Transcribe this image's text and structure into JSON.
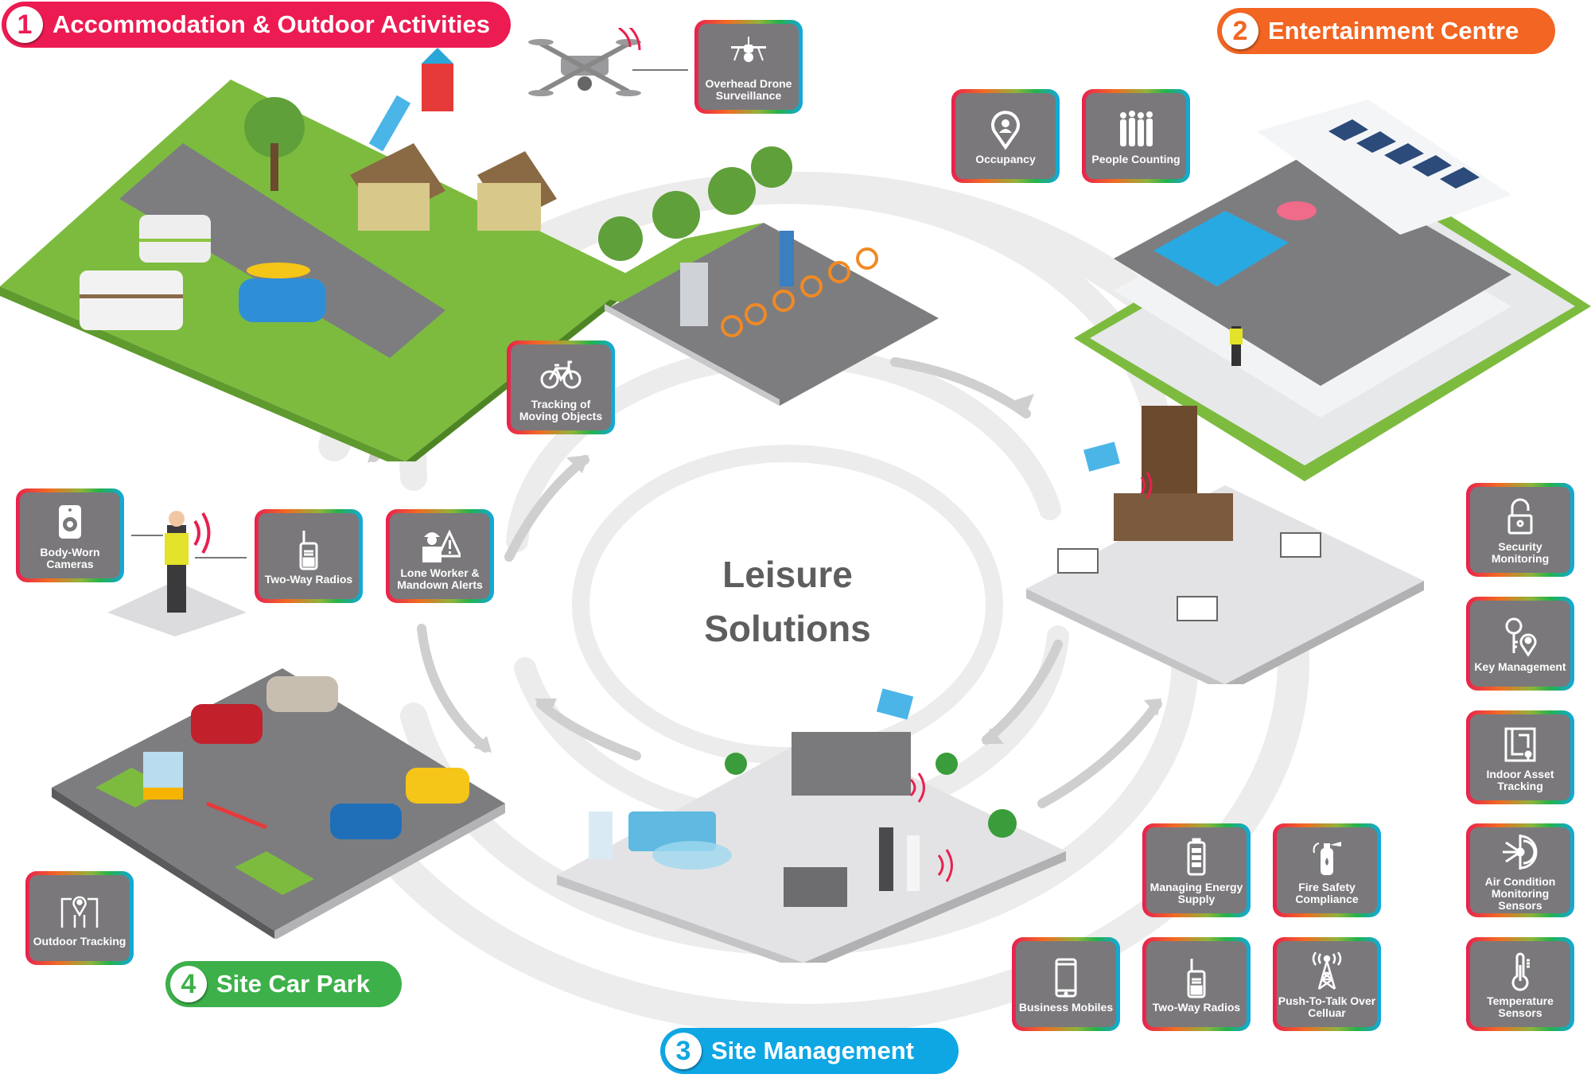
{
  "diagram": {
    "title_line1": "Leisure",
    "title_line2": "Solutions",
    "colors": {
      "accommodation": "#ec1b52",
      "entertainment": "#f26522",
      "site_management": "#0fa6e4",
      "car_park": "#3db04a",
      "tile_fill": "#7a787b",
      "grass": "#7dbb3f",
      "asphalt": "#7d7d80",
      "swirl": "#ececec"
    },
    "sections": [
      {
        "number": "1",
        "label": "Accommodation & Outdoor Activities"
      },
      {
        "number": "2",
        "label": "Entertainment Centre"
      },
      {
        "number": "3",
        "label": "Site Management"
      },
      {
        "number": "4",
        "label": "Site Car Park"
      }
    ],
    "tiles": {
      "drone": {
        "label": "Overhead Drone Surveillance",
        "icon": "drone-icon"
      },
      "occupancy": {
        "label": "Occupancy",
        "icon": "location-person-icon"
      },
      "people_counting": {
        "label": "People Counting",
        "icon": "people-icon"
      },
      "moving_objects": {
        "label": "Tracking of Moving Objects",
        "icon": "bicycle-icon"
      },
      "body_cameras": {
        "label": "Body-Worn Cameras",
        "icon": "body-camera-icon"
      },
      "two_way_radios_1": {
        "label": "Two-Way Radios",
        "icon": "radio-icon"
      },
      "lone_worker": {
        "label": "Lone Worker & Mandown Alerts",
        "icon": "worker-warning-icon"
      },
      "security": {
        "label": "Security Monitoring",
        "icon": "padlock-icon"
      },
      "key_management": {
        "label": "Key Management",
        "icon": "key-location-icon"
      },
      "indoor_asset": {
        "label": "Indoor Asset Tracking",
        "icon": "floorplan-icon"
      },
      "air_condition": {
        "label": "Air Condition Monitoring Sensors",
        "icon": "snowflake-fan-icon"
      },
      "temperature": {
        "label": "Temperature Sensors",
        "icon": "thermometer-icon"
      },
      "energy": {
        "label": "Managing Energy Supply",
        "icon": "battery-icon"
      },
      "fire_safety": {
        "label": "Fire Safety Compliance",
        "icon": "fire-extinguisher-icon"
      },
      "business_mobiles": {
        "label": "Business Mobiles",
        "icon": "smartphone-icon"
      },
      "two_way_radios_2": {
        "label": "Two-Way Radios",
        "icon": "radio-icon"
      },
      "ptt": {
        "label": "Push-To-Talk Over Celluar",
        "icon": "cell-tower-icon"
      },
      "outdoor_tracking": {
        "label": "Outdoor Tracking",
        "icon": "outdoor-location-icon"
      }
    }
  }
}
